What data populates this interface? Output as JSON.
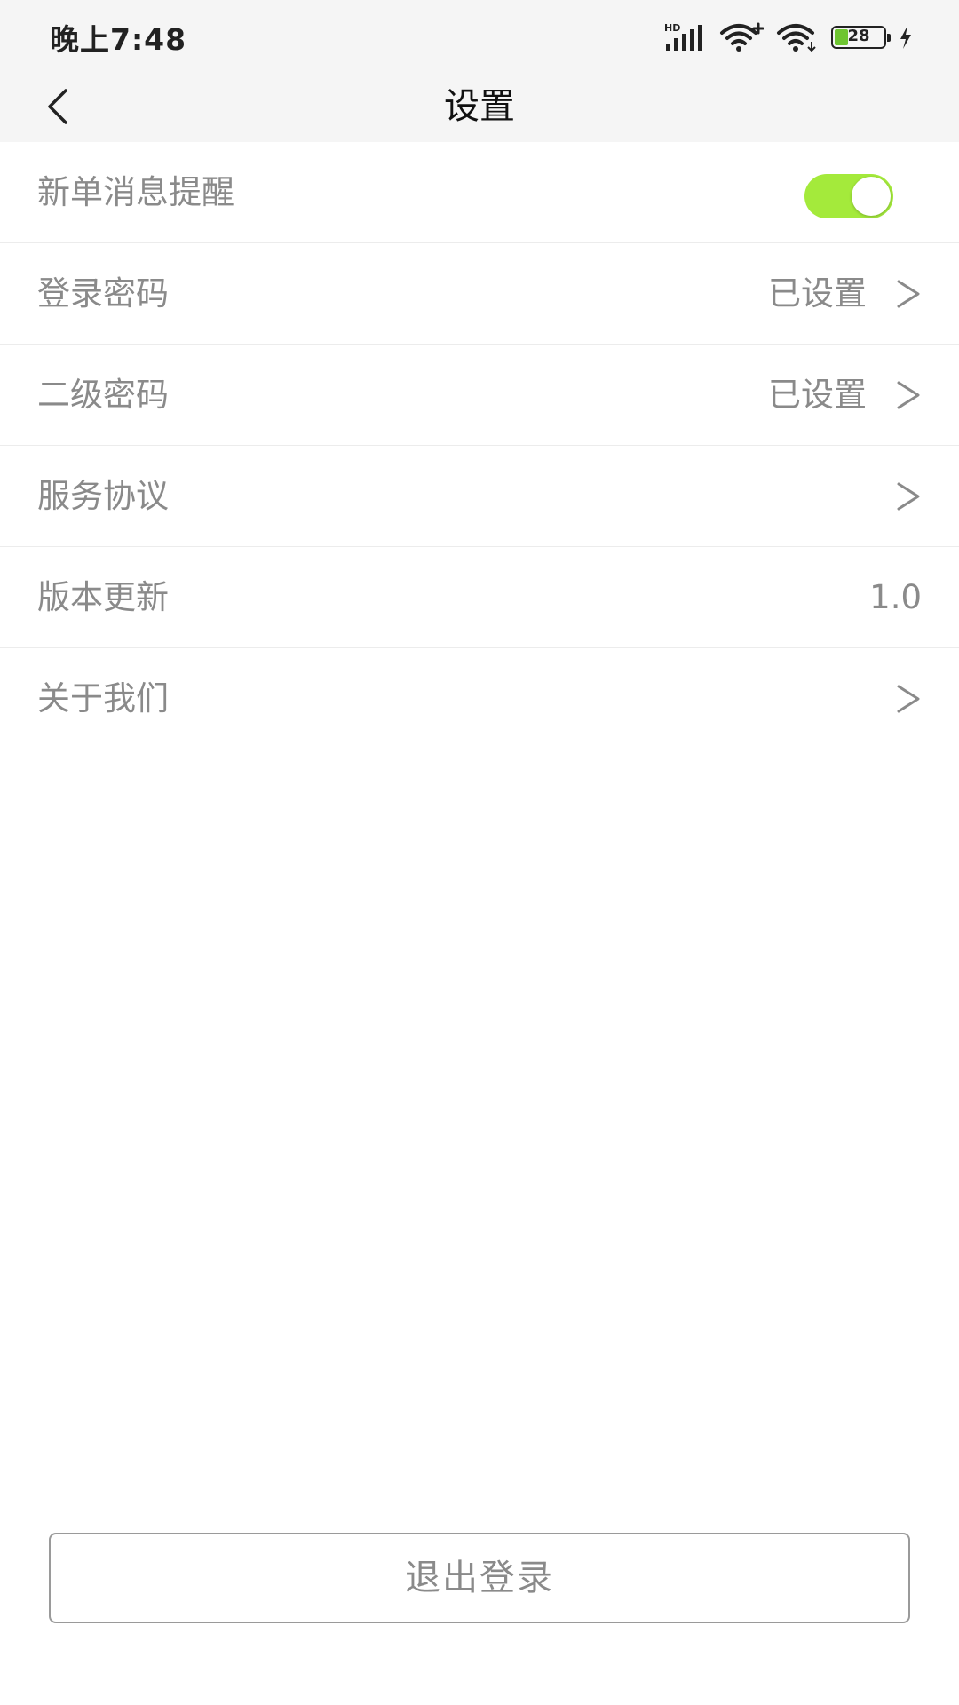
{
  "status_bar": {
    "time": "晚上7:48",
    "network_label": "HD",
    "battery_level": "28",
    "battery_fill_percent": 28
  },
  "nav": {
    "title": "设置",
    "back_icon": "chevron-left-icon"
  },
  "settings": [
    {
      "label": "新单消息提醒",
      "type": "toggle",
      "enabled": true
    },
    {
      "label": "登录密码",
      "value": "已设置",
      "chevron": true
    },
    {
      "label": "二级密码",
      "value": "已设置",
      "chevron": true
    },
    {
      "label": "服务协议",
      "value": "",
      "chevron": true
    },
    {
      "label": "版本更新",
      "value": "1.0",
      "chevron": false
    },
    {
      "label": "关于我们",
      "value": "",
      "chevron": true
    }
  ],
  "logout_label": "退出登录",
  "colors": {
    "header_bg": "#f5f5f5",
    "toggle_on": "#a4ea3b",
    "text_gray": "#8a8a8a",
    "battery_green": "#6ec531"
  }
}
